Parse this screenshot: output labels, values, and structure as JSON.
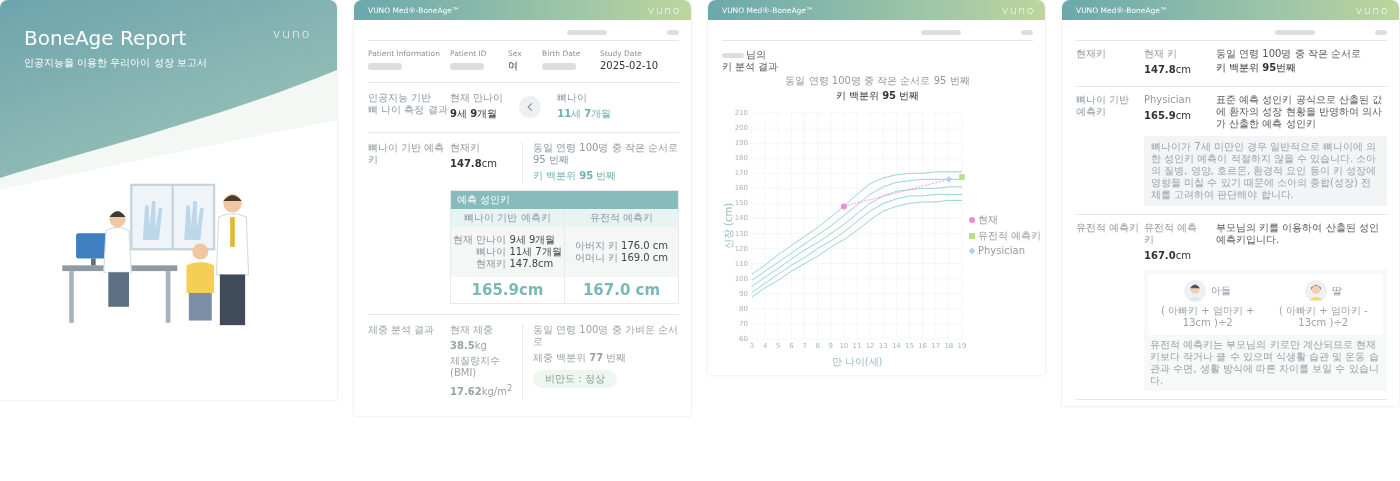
{
  "cover": {
    "title": "BoneAge Report",
    "subtitle": "인공지능을 이용한 우리아이 성장 보고서",
    "logo": "vuno"
  },
  "report_pages": [
    {
      "kind": "summary",
      "product": "VUNO Med®-BoneAge™",
      "logo": "vuno",
      "patient_info": [
        {
          "label": "Patient Information",
          "redacted": true
        },
        {
          "label": "Patient ID",
          "redacted": true
        },
        {
          "label": "Sex",
          "value": "여",
          "redacted": false
        },
        {
          "label": "Birth Date",
          "redacted": true
        },
        {
          "label": "Study Date",
          "value": "2025-02-10",
          "redacted": false
        }
      ],
      "bone_age": {
        "title": "인공지능 기반\n뼈 나이 측정 결과",
        "current_label": "현재 만나이",
        "current_value": "**9**세 **9**개월",
        "bone_label": "뼈나이",
        "bone_value": "**11**세 **7**개월"
      },
      "height": {
        "title": "뼈나이 기반 예측키",
        "current_label": "현재키",
        "current_value": "**147.8**cm",
        "rank_text": "동일 연령 100명 중 작은 순서로 95 번째",
        "percentile": "키 백분위 **95** 번째"
      },
      "prediction_table": {
        "title": "예측 성인키",
        "columns": [
          {
            "heading": "뼈나이 기반 예측키",
            "details": [
              {
                "label": "현재 만나이",
                "value": "9세 9개월"
              },
              {
                "label": "뼈나이",
                "value": "11세 7개월"
              },
              {
                "label": "현재키",
                "value": "147.8cm"
              }
            ],
            "result": "165.9cm"
          },
          {
            "heading": "유전적 예측키",
            "details": [
              {
                "label": "아버지 키",
                "value": "176.0 cm"
              },
              {
                "label": "어머니 키",
                "value": "169.0 cm"
              }
            ],
            "result": "167.0 cm"
          }
        ]
      },
      "weight": {
        "title": "체중 분석 결과",
        "current_label": "현재 체중",
        "current_value": "**38.5**kg",
        "bmi_label": "체질량지수 (BMI)",
        "bmi_value": "**17.62**kg/m$^{2}$",
        "rank_text": "동일 연령 100명 중 가벼운 순서로",
        "percentile": "체중 백분위 **77** 번째",
        "badge": "비만도 : 정상"
      }
    },
    {
      "kind": "chart",
      "product": "VUNO Med®-BoneAge™",
      "logo": "vuno",
      "name_suffix": "님의",
      "subtitle": "키 분석 결과",
      "rank_text": "동일 연령 100명 중 작은 순서로 95 번째",
      "percentile": "키 백분위 **95** 번째",
      "chart_data": {
        "type": "line",
        "xlabel": "만 나이(세)",
        "ylabel": "신장 (cm)",
        "grid": true,
        "legend": "right",
        "x": [
          3,
          4,
          5,
          6,
          7,
          8,
          9,
          10,
          11,
          12,
          13,
          14,
          15,
          16,
          17,
          18,
          19
        ],
        "xlim": [
          3,
          19
        ],
        "ylim": [
          60,
          210
        ],
        "xticks": [
          3,
          4,
          5,
          6,
          7,
          8,
          9,
          10,
          11,
          12,
          13,
          14,
          15,
          16,
          17,
          18,
          19
        ],
        "yticks": [
          60,
          70,
          80,
          90,
          100,
          110,
          120,
          130,
          140,
          150,
          160,
          170,
          180,
          190,
          200,
          210
        ],
        "series": [
          {
            "color": "#8fcfca",
            "values": [
              103,
              109,
              116,
              122,
              128,
              134,
              141,
              148,
              156,
              163,
              167,
              169,
              170,
              170,
              171,
              171,
              171
            ]
          },
          {
            "color": "#8fcfca",
            "values": [
              99,
              105,
              111,
              117,
              123,
              129,
              135,
              142,
              149,
              156,
              161,
              164,
              165,
              166,
              166,
              166,
              166
            ]
          },
          {
            "color": "#8fcfca",
            "values": [
              95,
              101,
              107,
              113,
              119,
              124,
              130,
              136,
              143,
              150,
              155,
              158,
              159,
              160,
              160,
              161,
              161
            ]
          },
          {
            "color": "#8fcfca",
            "values": [
              91,
              97,
              103,
              109,
              114,
              120,
              125,
              131,
              138,
              145,
              150,
              153,
              155,
              155,
              156,
              156,
              156
            ]
          },
          {
            "color": "#8fcfca",
            "values": [
              88,
              94,
              99,
              105,
              110,
              115,
              121,
              126,
              132,
              139,
              145,
              148,
              150,
              151,
              151,
              152,
              152
            ]
          },
          {
            "name": "현재",
            "color": "#ee8ad0",
            "line_style": "dashed",
            "marker": "circle",
            "values": [
              null,
              null,
              null,
              null,
              null,
              null,
              null,
              148,
              null,
              null,
              null,
              null,
              null,
              null,
              null,
              166,
              null
            ]
          },
          {
            "name": "유전적 예측키",
            "color": "#b8dd8e",
            "marker": "square",
            "values": [
              null,
              null,
              null,
              null,
              null,
              null,
              null,
              null,
              null,
              null,
              null,
              null,
              null,
              null,
              null,
              null,
              167.5
            ]
          },
          {
            "name": "Physician",
            "color": "#a7d3f5",
            "marker": "diamond",
            "values": [
              null,
              null,
              null,
              null,
              null,
              null,
              null,
              null,
              null,
              null,
              null,
              null,
              null,
              null,
              null,
              166,
              null
            ]
          }
        ]
      }
    },
    {
      "kind": "detail",
      "product": "VUNO Med®-BoneAge™",
      "logo": "vuno",
      "sections": [
        {
          "kind": "current",
          "title": "현재키",
          "value_label": "현재 키",
          "value": "**147.8**cm",
          "rank_text": "동일 연령 100명 중 작은 순서로",
          "percentile": "키 백분위 **95**번째"
        },
        {
          "kind": "physician",
          "title": "뼈나이 기반 예측키",
          "value_label": "Physician",
          "value": "**165.9**cm",
          "description": "표준 예측 성인키 공식으로 산출된 값에 환자의 성장 현황을 반영하여 의사가 산출한 예측 성인키",
          "note": "뼈나이가 7세 미만인 경우 일반적으로 뼈나이에 의한 성인키 예측이 적절하지 않을 수 있습니다. 소아의 질병, 영양, 호르몬, 환경적 요인 등이 키 성장에 영향을 미칠 수 있기 때문에 소아의 종합(성장) 전체를 고려하여 판단해야 합니다."
        },
        {
          "kind": "genetic",
          "title": "유전적 예측키",
          "value_label": "유전적 예측키",
          "value": "**167.0**cm",
          "description": "부모님의 키를 이용하여 산출된 성인 예측키입니다.",
          "formulas": [
            {
              "kind": "boy",
              "label": "아들",
              "formula": "( 아빠키 + 엄마키 + 13cm )÷2"
            },
            {
              "kind": "girl",
              "label": "딸",
              "formula": "( 아빠키 + 엄마키 - 13cm )÷2"
            }
          ],
          "note": "유전적 예측키는 부모님의 키로만 계산되므로 현재 키보다 작거나 클 수 있으며 식생활 습관 및 운동 습관과 수면, 생활 방식에 따른 차이를 보일 수 있습니다."
        }
      ]
    }
  ]
}
